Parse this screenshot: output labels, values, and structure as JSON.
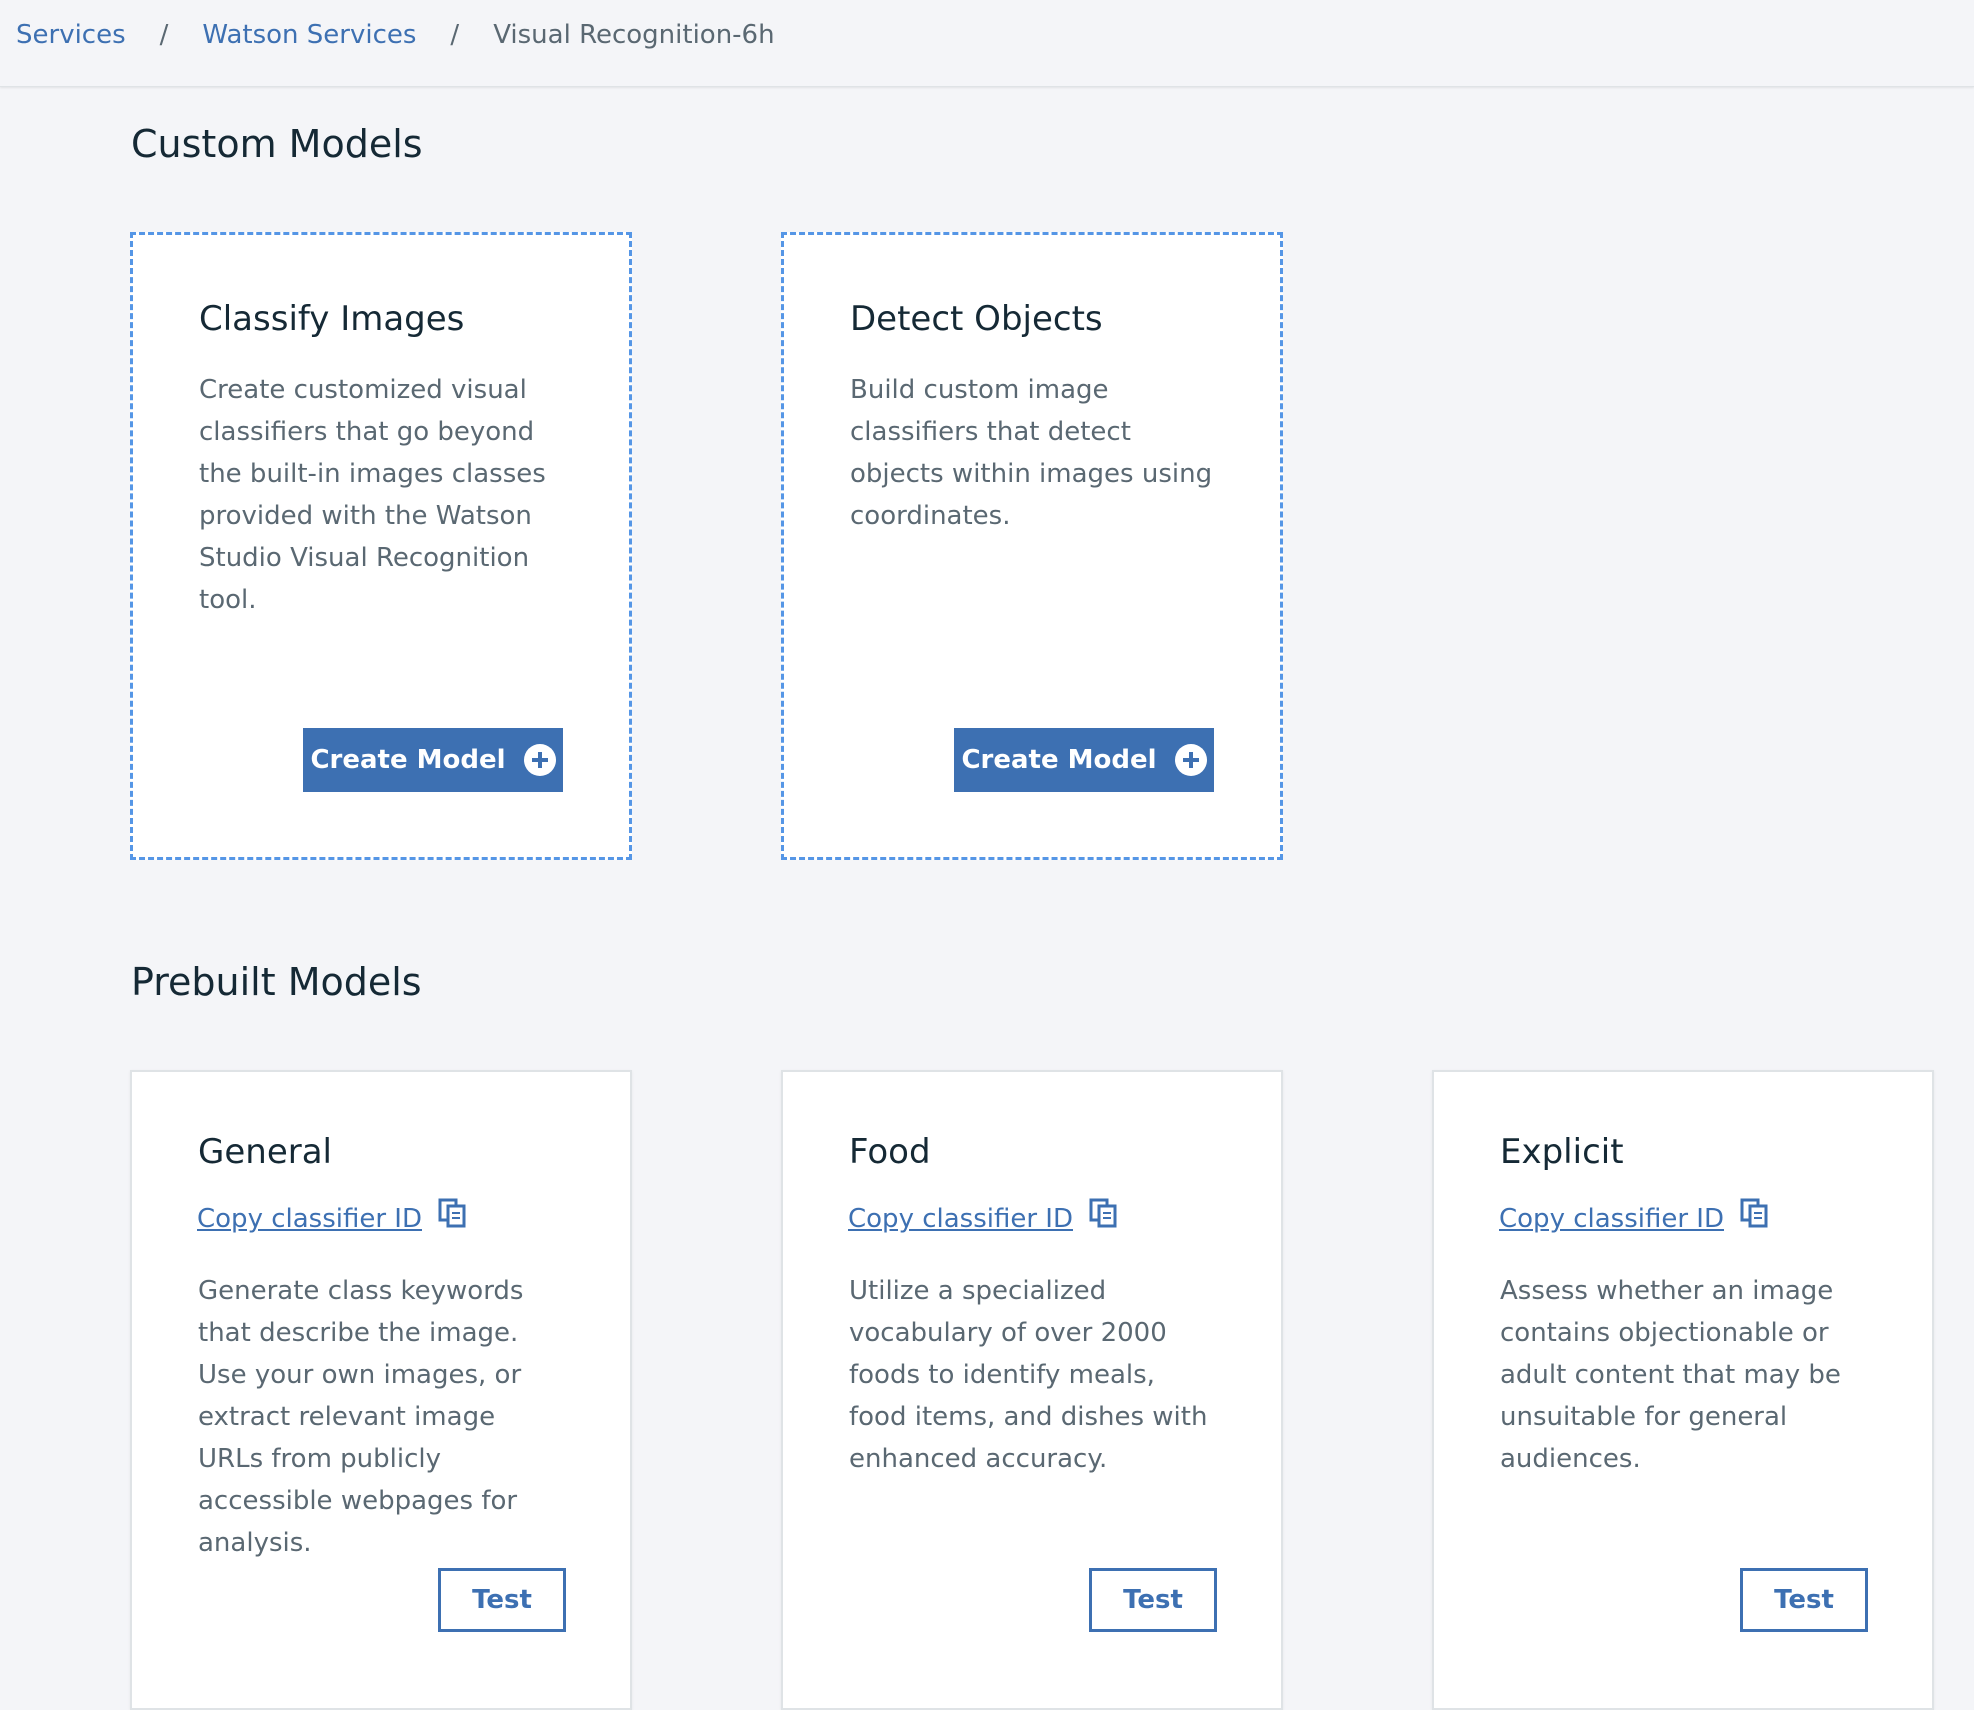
{
  "breadcrumb": {
    "items": [
      "Services",
      "Watson Services"
    ],
    "separator": "/",
    "current": "Visual Recognition-6h"
  },
  "custom_models": {
    "title": "Custom Models",
    "cards": [
      {
        "title": "Classify Images",
        "description": "Create customized visual classifiers that go beyond the built-in images classes provided with the Watson Studio Visual Recognition tool.",
        "button_label": "Create Model"
      },
      {
        "title": "Detect Objects",
        "description": "Build custom image classifiers that detect objects within images using coordinates.",
        "button_label": "Create Model"
      }
    ]
  },
  "prebuilt_models": {
    "title": "Prebuilt Models",
    "cards": [
      {
        "title": "General",
        "copy_label": "Copy classifier ID",
        "description": "Generate class keywords that describe the image. Use your own images, or extract relevant image URLs from publicly accessible webpages for analysis.",
        "button_label": "Test"
      },
      {
        "title": "Food",
        "copy_label": "Copy classifier ID",
        "description": "Utilize a specialized vocabulary of over 2000 foods to identify meals, food items, and dishes with enhanced accuracy.",
        "button_label": "Test"
      },
      {
        "title": "Explicit",
        "copy_label": "Copy classifier ID",
        "description": "Assess whether an image contains objectionable or adult content that may be unsuitable for general audiences.",
        "button_label": "Test"
      }
    ]
  },
  "icons": {
    "create": "plus-circle-icon",
    "copy": "copy-icon"
  },
  "colors": {
    "accent": "#3d70b2",
    "dashed_border": "#5596e6",
    "background": "#f4f5f8",
    "text_primary": "#152935",
    "text_secondary": "#5a6872"
  }
}
